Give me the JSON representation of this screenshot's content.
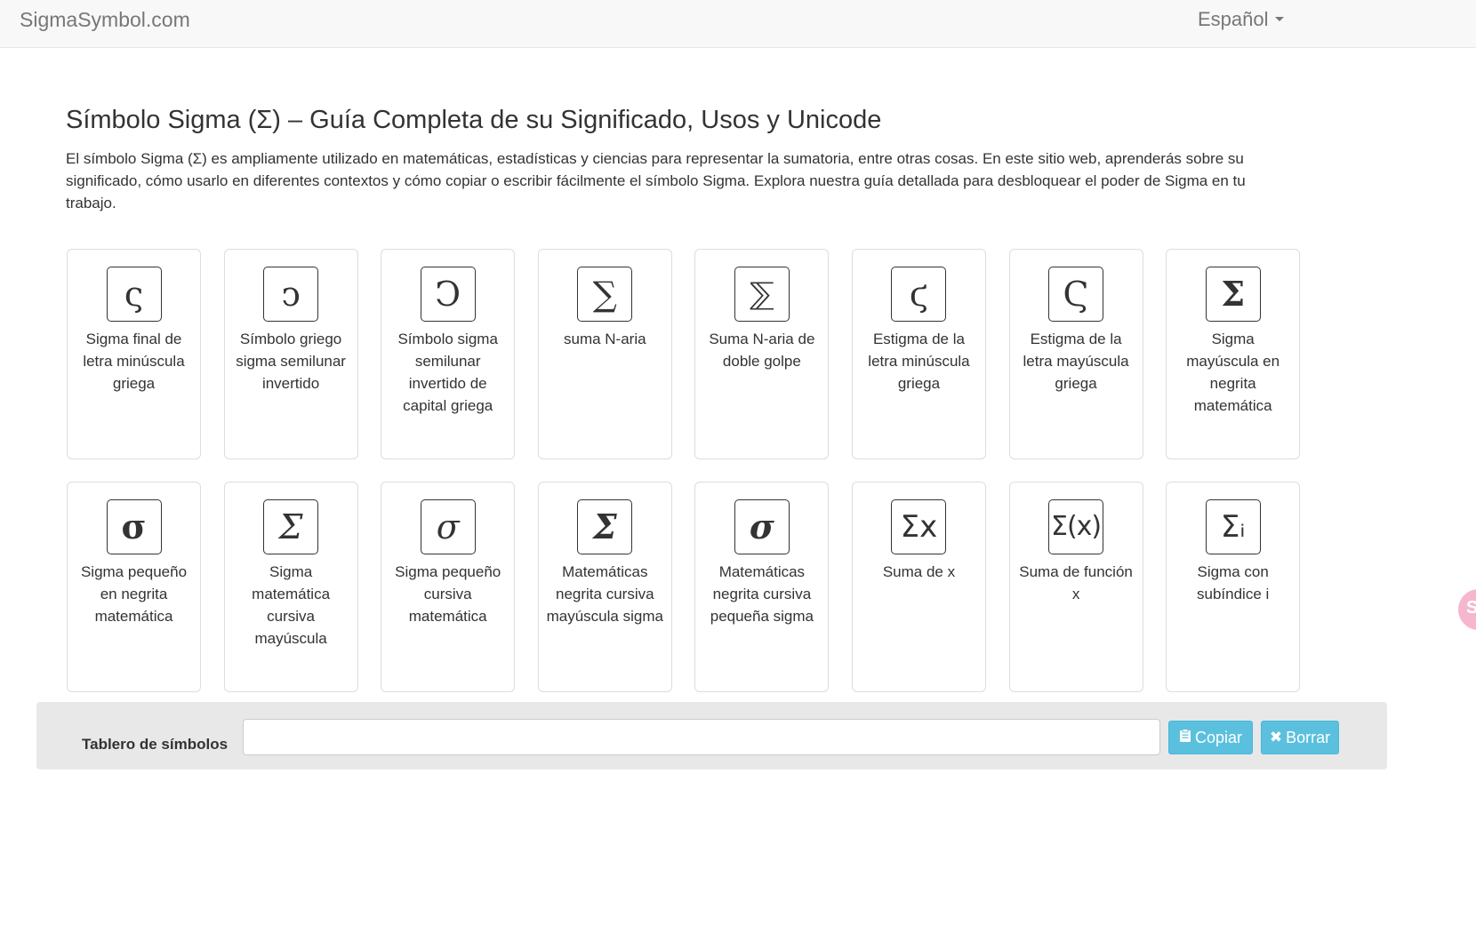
{
  "header": {
    "brand": "SigmaSymbol.com",
    "language": "Español"
  },
  "main": {
    "title": "Símbolo Sigma (Σ) – Guía Completa de su Significado, Usos y Unicode",
    "intro": "El símbolo Sigma (Σ) es ampliamente utilizado en matemáticas, estadísticas y ciencias para representar la sumatoria, entre otras cosas. En este sitio web, aprenderás sobre su significado, cómo usarlo en diferentes contextos y cómo copiar o escribir fácilmente el símbolo Sigma. Explora nuestra guía detallada para desbloquear el poder de Sigma en tu trabajo."
  },
  "symbols": [
    {
      "symbol": "ς",
      "label": "Sigma final de letra minúscula griega",
      "name": "card-final-sigma"
    },
    {
      "symbol": "ͻ",
      "label": "Símbolo griego sigma semilunar invertido",
      "name": "card-reversed-lunate-sigma-small"
    },
    {
      "symbol": "Ͻ",
      "label": "Símbolo sigma semilunar invertido de capital griega",
      "name": "card-reversed-lunate-sigma-capital"
    },
    {
      "symbol": "∑",
      "label": "suma N-aria",
      "name": "card-n-ary-summation"
    },
    {
      "symbol": "⅀",
      "label": "Suma N-aria de doble golpe",
      "name": "card-double-struck-summation"
    },
    {
      "symbol": "ϛ",
      "label": "Estigma de la letra minúscula griega",
      "name": "card-stigma-small"
    },
    {
      "symbol": "Ϛ",
      "label": "Estigma de la letra mayúscula griega",
      "name": "card-stigma-capital"
    },
    {
      "symbol": "𝚺",
      "label": "Sigma mayúscula en negrita matemática",
      "name": "card-math-bold-capital-sigma"
    },
    {
      "symbol": "𝛔",
      "label": "Sigma pequeño en negrita matemática",
      "name": "card-math-bold-small-sigma"
    },
    {
      "symbol": "𝛴",
      "label": "Sigma matemática cursiva mayúscula",
      "name": "card-math-italic-capital-sigma"
    },
    {
      "symbol": "𝜎",
      "label": "Sigma pequeño cursiva matemática",
      "name": "card-math-italic-small-sigma"
    },
    {
      "symbol": "𝜮",
      "label": "Matemáticas negrita cursiva mayúscula sigma",
      "name": "card-math-bold-italic-capital-sigma"
    },
    {
      "symbol": "𝝈",
      "label": "Matemáticas negrita cursiva pequeña sigma",
      "name": "card-math-bold-italic-small-sigma"
    },
    {
      "symbol": "Σx",
      "label": "Suma de x",
      "name": "card-sum-of-x"
    },
    {
      "symbol": "Σ(x)",
      "label": "Suma de función x",
      "name": "card-sum-of-function-x"
    },
    {
      "symbol": "Σᵢ",
      "label": "Sigma con subíndice i",
      "name": "card-sigma-subscript-i"
    }
  ],
  "toolbar": {
    "label": "Tablero de símbolos",
    "input_value": "",
    "copy_label": "Copiar",
    "clear_label": "Borrar"
  },
  "icons": {
    "copy": "clipboard-icon",
    "clear": "close-icon",
    "language": "caret-down-icon"
  },
  "colors": {
    "navbar_bg": "#f8f8f8",
    "button_info": "#5bc0de",
    "toolbar_bg": "#e8e8e8",
    "floating_badge": "#f7b6cf"
  }
}
